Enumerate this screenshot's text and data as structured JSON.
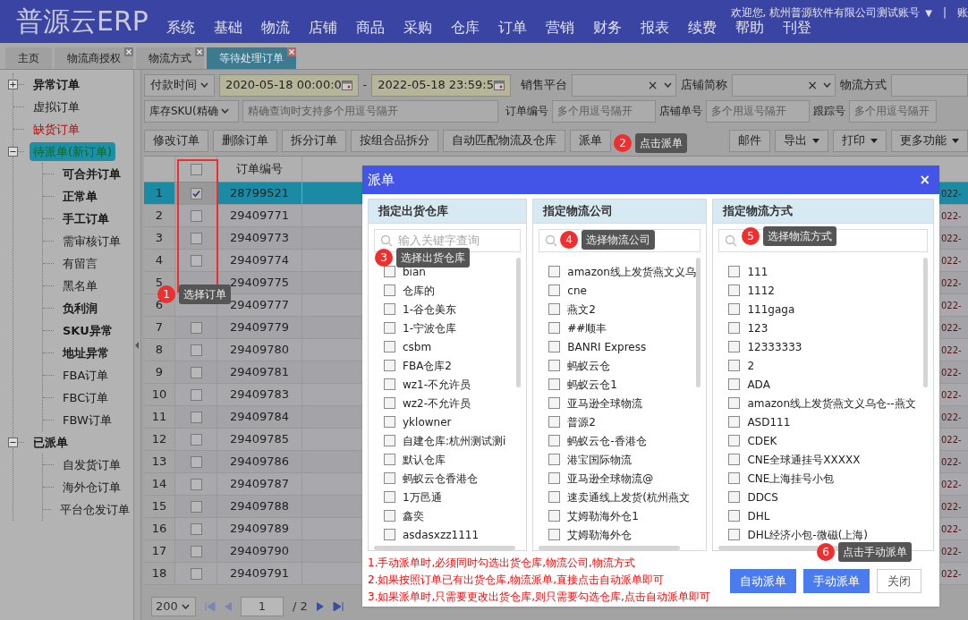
{
  "header": {
    "logo": "普源云ERP",
    "nav": [
      "系统",
      "基础",
      "物流",
      "店铺",
      "商品",
      "采购",
      "仓库",
      "订单",
      "营销",
      "财务",
      "报表",
      "续费",
      "帮助",
      "刊登"
    ],
    "welcome": "欢迎您, 杭州普源软件有限公司测试账号",
    "caret": "▼",
    "divider": "|",
    "account": "账"
  },
  "tabs": [
    {
      "label": "主页",
      "selected": false,
      "closable": false
    },
    {
      "label": "物流商授权",
      "selected": false,
      "closable": true
    },
    {
      "label": "物流方式",
      "selected": false,
      "closable": true
    },
    {
      "label": "等待处理订单",
      "selected": true,
      "closable": true
    }
  ],
  "sidebar": {
    "items": [
      {
        "label": "异常订单",
        "bold": true,
        "kind": "normal",
        "selected": false,
        "expanded": false
      },
      {
        "label": "虚拟订单",
        "bold": false,
        "kind": "normal",
        "selected": false
      },
      {
        "label": "缺货订单",
        "bold": false,
        "kind": "warning",
        "selected": false
      },
      {
        "label": "待派单(新订单)",
        "bold": false,
        "kind": "normal",
        "selected": true,
        "expanded": true,
        "children": [
          {
            "label": "可合并订单",
            "bold": true,
            "selected": false
          },
          {
            "label": "正常单",
            "bold": true,
            "selected": false
          },
          {
            "label": "手工订单",
            "bold": true,
            "selected": false
          },
          {
            "label": "需审核订单",
            "bold": false,
            "selected": false
          },
          {
            "label": "有留言",
            "bold": false,
            "selected": false
          },
          {
            "label": "黑名单",
            "bold": false,
            "selected": false
          },
          {
            "label": "负利润",
            "bold": true,
            "selected": false
          },
          {
            "label": "SKU异常",
            "bold": true,
            "selected": false
          },
          {
            "label": "地址异常",
            "bold": true,
            "selected": false
          },
          {
            "label": "FBA订单",
            "bold": false,
            "selected": false
          },
          {
            "label": "FBC订单",
            "bold": false,
            "selected": false
          },
          {
            "label": "FBW订单",
            "bold": false,
            "selected": false
          }
        ]
      },
      {
        "label": "已派单",
        "bold": true,
        "kind": "normal",
        "selected": false,
        "expanded": true,
        "children": [
          {
            "label": "自发货订单",
            "bold": false,
            "selected": false
          },
          {
            "label": "海外仓订单",
            "bold": false,
            "selected": false
          },
          {
            "label": "平台仓发订单",
            "bold": false,
            "selected": false
          }
        ]
      }
    ]
  },
  "filters": {
    "time_select": "付款时间",
    "date_from": "2020-05-18 00:00:0",
    "dash": "-",
    "date_to": "2022-05-18 23:59:5",
    "platform_label": "销售平台",
    "shop_label": "店铺简称",
    "shipping_label": "物流方式",
    "sku_select": "库存SKU(精确",
    "sku_placeholder": "精确查询时支持多个用逗号隔开",
    "order_label": "订单编号",
    "order_placeholder": "多个用逗号隔开",
    "shop_no_label": "店铺单号",
    "shop_no_placeholder": "多个用逗号隔开",
    "tracking_label": "跟踪号",
    "tracking_placeholder": "多个用逗号隔开",
    "clear": "×"
  },
  "toolbar": [
    {
      "label": "修改订单",
      "dropdown": false
    },
    {
      "label": "删除订单",
      "dropdown": false
    },
    {
      "label": "拆分订单",
      "dropdown": false
    },
    {
      "label": "按组合品拆分",
      "dropdown": false
    },
    {
      "label": "自动匹配物流及仓库",
      "dropdown": false
    },
    {
      "label": "派单",
      "dropdown": false
    },
    {
      "label": "邮件",
      "dropdown": false
    },
    {
      "label": "导出",
      "dropdown": true
    },
    {
      "label": "打印",
      "dropdown": true
    },
    {
      "label": "更多功能",
      "dropdown": true
    }
  ],
  "table": {
    "order_column": "订单编号",
    "all_checked": false,
    "rows": [
      {
        "n": "1",
        "checked": true,
        "selected": true,
        "order": "28799521",
        "date": "022-"
      },
      {
        "n": "2",
        "checked": false,
        "selected": false,
        "order": "29409771",
        "date": "022-"
      },
      {
        "n": "3",
        "checked": false,
        "selected": false,
        "order": "29409773",
        "date": "022-"
      },
      {
        "n": "4",
        "checked": false,
        "selected": false,
        "order": "29409774",
        "date": "022-"
      },
      {
        "n": "5",
        "selected": false,
        "order": "29409775",
        "date": "022-"
      },
      {
        "n": "6",
        "selected": false,
        "order": "29409777",
        "date": "022-"
      },
      {
        "n": "7",
        "checked": false,
        "selected": false,
        "order": "29409779",
        "date": "022-"
      },
      {
        "n": "8",
        "checked": false,
        "selected": false,
        "order": "29409780",
        "date": "022-"
      },
      {
        "n": "9",
        "checked": false,
        "selected": false,
        "order": "29409781",
        "date": "022-"
      },
      {
        "n": "10",
        "checked": false,
        "selected": false,
        "order": "29409783",
        "date": "022-"
      },
      {
        "n": "11",
        "checked": false,
        "selected": false,
        "order": "29409784",
        "date": "022-"
      },
      {
        "n": "12",
        "checked": false,
        "selected": false,
        "order": "29409785",
        "date": "022-"
      },
      {
        "n": "13",
        "checked": false,
        "selected": false,
        "order": "29409786",
        "date": "022-"
      },
      {
        "n": "14",
        "checked": false,
        "selected": false,
        "order": "29409787",
        "date": "022-"
      },
      {
        "n": "15",
        "checked": false,
        "selected": false,
        "order": "29409788",
        "date": "022-"
      },
      {
        "n": "16",
        "checked": false,
        "selected": false,
        "order": "29409789",
        "date": "022-"
      },
      {
        "n": "17",
        "checked": false,
        "selected": false,
        "order": "29409790",
        "date": "022-"
      },
      {
        "n": "18",
        "checked": false,
        "selected": false,
        "order": "29409791",
        "date": "022-"
      }
    ]
  },
  "pager": {
    "page_size": "200",
    "page": "1",
    "total": "/ 2"
  },
  "dialog": {
    "title": "派单",
    "close": "×",
    "columns": [
      {
        "title": "指定出货仓库",
        "placeholder": "输入关键字查询",
        "items": [
          {
            "label": "bian",
            "checked": false
          },
          {
            "label": "仓库的",
            "checked": false
          },
          {
            "label": "1-谷仓美东",
            "checked": false
          },
          {
            "label": "1-宁波仓库",
            "checked": false
          },
          {
            "label": "csbm",
            "checked": false
          },
          {
            "label": "FBA仓库2",
            "checked": false
          },
          {
            "label": "wz1-不允许员",
            "checked": false
          },
          {
            "label": "wz2-不允许员",
            "checked": false
          },
          {
            "label": "yklowner",
            "checked": false
          },
          {
            "label": "自建仓库:杭州测试测i",
            "checked": false
          },
          {
            "label": "默认仓库",
            "checked": false
          },
          {
            "label": "蚂蚁云仓香港仓",
            "checked": false
          },
          {
            "label": "1万邑通",
            "checked": false
          },
          {
            "label": "鑫奕",
            "checked": false
          },
          {
            "label": "asdasxzz1111",
            "checked": false
          }
        ]
      },
      {
        "title": "指定物流公司",
        "items": [
          {
            "label": "amazon线上发货燕文义乌",
            "checked": false
          },
          {
            "label": "cne",
            "checked": false
          },
          {
            "label": "燕文2",
            "checked": false
          },
          {
            "label": "##顺丰",
            "checked": false
          },
          {
            "label": "BANRI Express",
            "checked": false
          },
          {
            "label": "蚂蚁云仓",
            "checked": false
          },
          {
            "label": "蚂蚁云仓1",
            "checked": false
          },
          {
            "label": "亚马逊全球物流",
            "checked": false
          },
          {
            "label": "普源2",
            "checked": false
          },
          {
            "label": "蚂蚁云仓-香港仓",
            "checked": false
          },
          {
            "label": "港宝国际物流",
            "checked": false
          },
          {
            "label": "亚马逊全球物流@",
            "checked": false
          },
          {
            "label": "速卖通线上发货(杭州燕文",
            "checked": false
          },
          {
            "label": "艾姆勒海外仓1",
            "checked": false
          },
          {
            "label": "艾姆勒海外仓",
            "checked": false
          }
        ]
      },
      {
        "title": "指定物流方式",
        "items": [
          {
            "label": "111",
            "checked": false
          },
          {
            "label": "1112",
            "checked": false
          },
          {
            "label": "111gaga",
            "checked": false
          },
          {
            "label": "123",
            "checked": false
          },
          {
            "label": "12333333",
            "checked": false
          },
          {
            "label": "2",
            "checked": false
          },
          {
            "label": "ADA",
            "checked": false
          },
          {
            "label": "amazon线上发货燕文义乌仓--燕文",
            "checked": false
          },
          {
            "label": "ASD111",
            "checked": false
          },
          {
            "label": "CDEK",
            "checked": false
          },
          {
            "label": "CNE全球通挂号XXXXX",
            "checked": false
          },
          {
            "label": "CNE上海挂号小包",
            "checked": false
          },
          {
            "label": "DDCS",
            "checked": false
          },
          {
            "label": "DHL",
            "checked": false
          },
          {
            "label": "DHL经济小包-微磁(上海)",
            "checked": false
          }
        ]
      }
    ],
    "notes": [
      "1.手动派单时,必须同时勾选出货仓库,物流公司,物流方式",
      "2.如果按照订单已有出货仓库,物流派单,直接点击自动派单即可",
      "3.如果派单时,只需要更改出货仓库,则只需要勾选仓库,点击自动派单即可"
    ],
    "buttons": [
      {
        "label": "自动派单",
        "kind": "primary"
      },
      {
        "label": "手动派单",
        "kind": "primary"
      },
      {
        "label": "关闭",
        "kind": "plain"
      }
    ]
  },
  "callouts": [
    {
      "number": "1",
      "text": "选择订单"
    },
    {
      "number": "2",
      "text": "点击派单"
    },
    {
      "number": "3",
      "text": "选择出货仓库"
    },
    {
      "number": "4",
      "text": "选择物流公司"
    },
    {
      "number": "5",
      "text": "选择物流方式"
    },
    {
      "number": "6",
      "text": "点击手动派单"
    }
  ]
}
